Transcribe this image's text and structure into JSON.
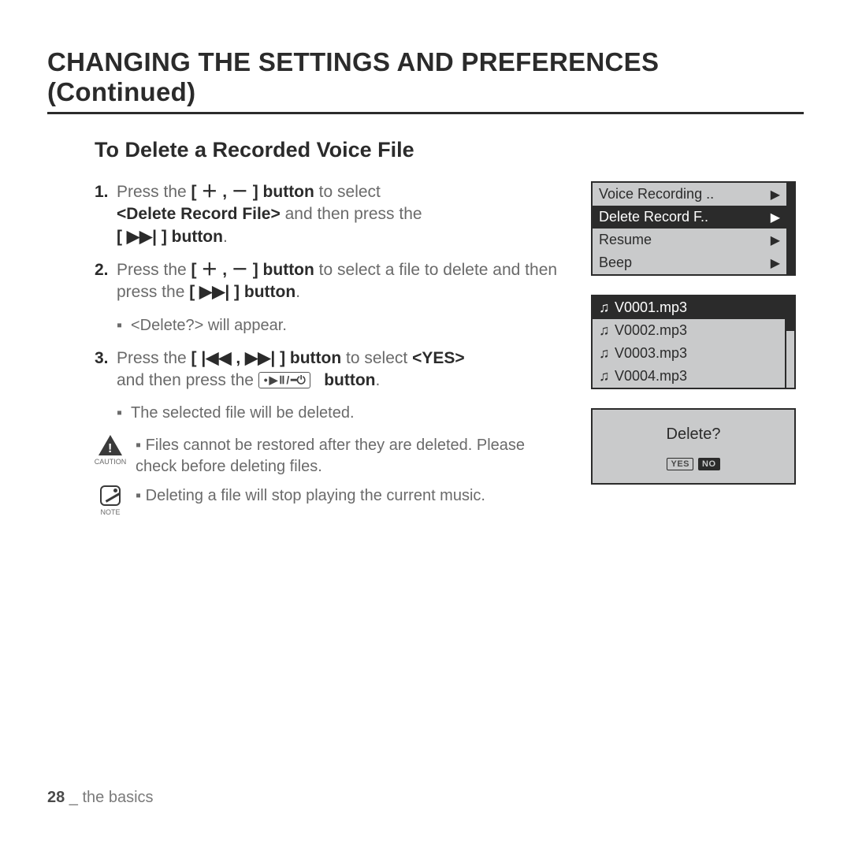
{
  "page_title": "CHANGING THE SETTINGS AND PREFERENCES (Continued)",
  "section_title": "To Delete a Recorded Voice File",
  "steps": {
    "s1": {
      "num": "1.",
      "a": "Press the ",
      "b": "[ ＋ , － ] button",
      "c": " to select ",
      "d": "<Delete Record File>",
      "e": " and then press the ",
      "f": "[ ▶▶| ] button",
      "g": "."
    },
    "s2": {
      "num": "2.",
      "a": "Press the ",
      "b": "[ ＋ , － ] button",
      "c": " to select a file to delete and then press the ",
      "d": "[ ▶▶| ] button",
      "e": ".",
      "sub": "<Delete?> will appear."
    },
    "s3": {
      "num": "3.",
      "a": "Press the ",
      "b": "[ |◀◀ , ▶▶| ] button",
      "c": " to select ",
      "d": "<YES>",
      "e": " and then press the ",
      "f_btn": "• ▶ ⅠⅠ / ━⏻",
      "g": "button",
      "h": ".",
      "sub": "The selected file will be deleted."
    }
  },
  "caution": {
    "label": "CAUTION",
    "text": "Files cannot be restored after they are deleted. Please check before deleting files."
  },
  "note": {
    "label": "NOTE",
    "text": "Deleting a file will stop playing the current music."
  },
  "bullet": "▪",
  "screen1": {
    "items": [
      {
        "label": "Voice Recording ..",
        "sel": false
      },
      {
        "label": "Delete Record F..",
        "sel": true
      },
      {
        "label": "Resume",
        "sel": false
      },
      {
        "label": "Beep",
        "sel": false
      }
    ]
  },
  "screen2": {
    "files": [
      {
        "name": "V0001.mp3",
        "sel": true
      },
      {
        "name": "V0002.mp3",
        "sel": false
      },
      {
        "name": "V0003.mp3",
        "sel": false
      },
      {
        "name": "V0004.mp3",
        "sel": false
      }
    ]
  },
  "screen3": {
    "prompt": "Delete?",
    "yes": "YES",
    "no": "NO"
  },
  "footer": {
    "page": "28",
    "sep": " _ ",
    "section": "the basics"
  },
  "arrow": "▶"
}
